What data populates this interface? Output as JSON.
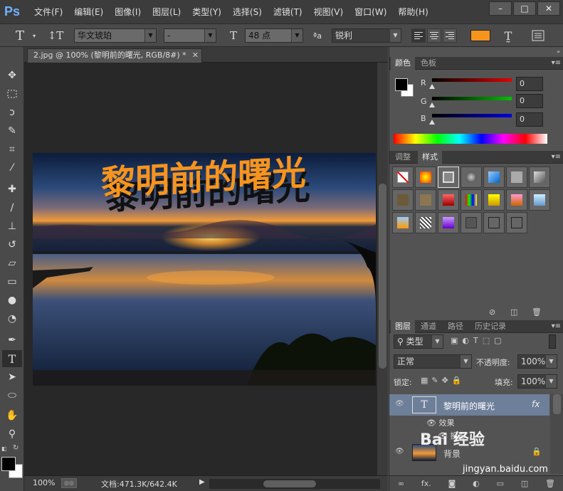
{
  "app": {
    "logo": "Ps"
  },
  "menu": [
    "文件(F)",
    "编辑(E)",
    "图像(I)",
    "图层(L)",
    "类型(Y)",
    "选择(S)",
    "滤镜(T)",
    "视图(V)",
    "窗口(W)",
    "帮助(H)"
  ],
  "window_controls": [
    "–",
    "□",
    "✕"
  ],
  "options": {
    "font_family": "华文琥珀",
    "font_style": "-",
    "font_size": "48 点",
    "antialias": "锐利",
    "text_color": "#f7941d"
  },
  "document": {
    "tab_title": "2.jpg @ 100% (黎明前的曙光, RGB/8#) *",
    "close": "✕",
    "canvas_text": "黎明前的曙光",
    "zoom": "100%",
    "info": "文档:471.3K/642.4K"
  },
  "color_panel": {
    "tabs": [
      "颜色",
      "色板"
    ],
    "channels": [
      {
        "label": "R",
        "value": "0",
        "color": "#e00000"
      },
      {
        "label": "G",
        "value": "0",
        "color": "#00c000"
      },
      {
        "label": "B",
        "value": "0",
        "color": "#0000e0"
      }
    ]
  },
  "styles_panel": {
    "tabs": [
      "调整",
      "样式"
    ]
  },
  "layers_panel": {
    "tabs": [
      "图层",
      "通道",
      "路径",
      "历史记录"
    ],
    "filter_kind": "类型",
    "blend_mode": "正常",
    "opacity_label": "不透明度:",
    "opacity_value": "100%",
    "lock_label": "锁定:",
    "fill_label": "填充:",
    "fill_value": "100%",
    "layers": [
      {
        "name": "黎明前的曙光",
        "fx": "fx"
      },
      {
        "name": "背景"
      }
    ],
    "effects_label": "效果",
    "effect_drop_shadow": "投影"
  },
  "watermark": {
    "brand": "Bai 经验",
    "url": "jingyan.baidu.com"
  }
}
